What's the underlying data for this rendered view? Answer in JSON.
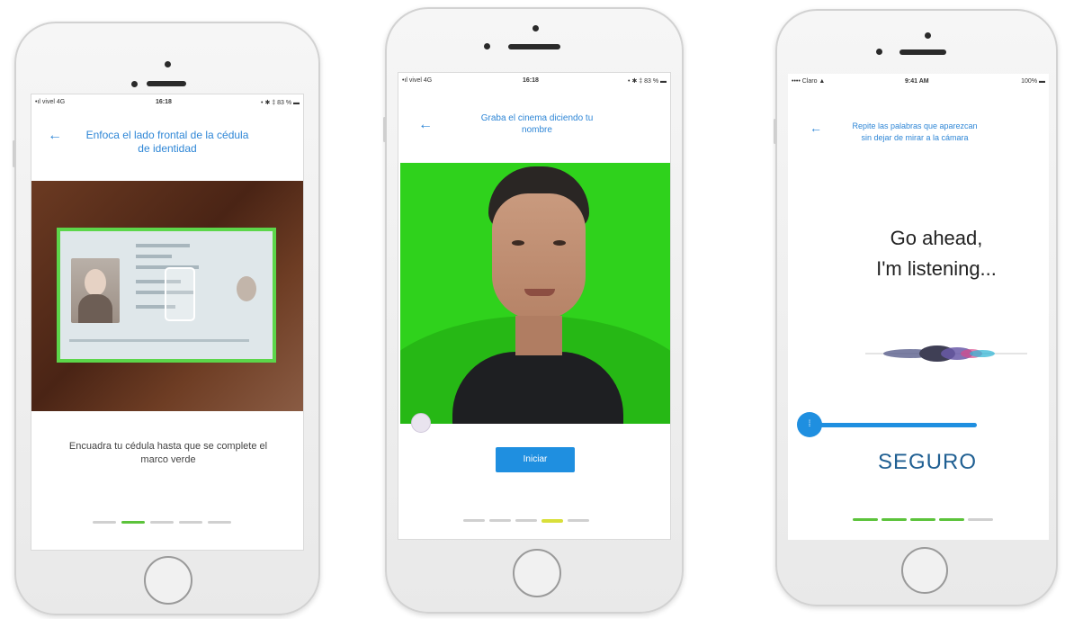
{
  "screen1": {
    "status": {
      "carrier": "•ıl vivel 4G",
      "time": "16:18",
      "battery": "• ✱ ‡ 83 % ▬"
    },
    "title": "Enfoca el lado frontal de la cédula de identidad",
    "instruction": "Encuadra tu cédula hasta que se complete el marco verde",
    "progress": {
      "total": 5,
      "active": 2
    }
  },
  "screen2": {
    "status": {
      "carrier": "•ıl vivel 4G",
      "time": "16:18",
      "battery": "• ✱ ‡ 83 % ▬"
    },
    "title": "Graba el cinema diciendo tu nombre",
    "button_label": "Iniciar",
    "progress": {
      "total": 5,
      "active": 4
    }
  },
  "screen3": {
    "status": {
      "carrier": "•••• Claro ▲",
      "time": "9:41 AM",
      "battery": "100% ▬"
    },
    "title": "Repite las palabras que aparezcan sin dejar de mirar a la cámara",
    "listening_line1": "Go ahead,",
    "listening_line2": "I'm listening...",
    "word": "SEGURO",
    "progress": {
      "total": 5,
      "active_upto": 4
    }
  },
  "colors": {
    "accent_blue": "#2e86d6",
    "progress_green": "#5cc33b",
    "green_screen": "#2fd21c",
    "slider_blue": "#1f8fe0"
  }
}
